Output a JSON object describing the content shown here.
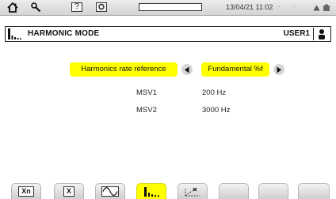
{
  "status_bar": {
    "home_icon": "home-icon",
    "settings_icon": "wrench-icon",
    "help_box": "?",
    "camera_box": "camera-icon",
    "datetime": "13/04/21 11:02",
    "battery_icon": "battery-icon"
  },
  "title_bar": {
    "mode_icon": "harmonic-bars-icon",
    "title": "HARMONIC MODE",
    "user": "USER1",
    "user_icon": "user-icon"
  },
  "settings": {
    "harmonics_ref_label": "Harmonics rate reference",
    "harmonics_ref_value": "Fundamental %f",
    "msv1_label": "MSV1",
    "msv1_value": "200 Hz",
    "msv2_label": "MSV2",
    "msv2_value": "3000 Hz"
  },
  "tabs": [
    {
      "label": "Xn",
      "icon": "xn-icon",
      "active": false
    },
    {
      "label": "X",
      "icon": "x-icon",
      "active": false
    },
    {
      "label": "",
      "icon": "waveform-icon",
      "active": false
    },
    {
      "label": "",
      "icon": "harmonic-bars-icon",
      "active": true
    },
    {
      "label": "",
      "icon": "vector-diagram-icon",
      "active": false
    },
    {
      "label": "",
      "icon": "",
      "active": false
    },
    {
      "label": "",
      "icon": "",
      "active": false
    },
    {
      "label": "",
      "icon": "",
      "active": false
    },
    {
      "label": "",
      "icon": "",
      "active": false
    }
  ],
  "colors": {
    "highlight": "#ffff00",
    "frame": "#222222"
  }
}
